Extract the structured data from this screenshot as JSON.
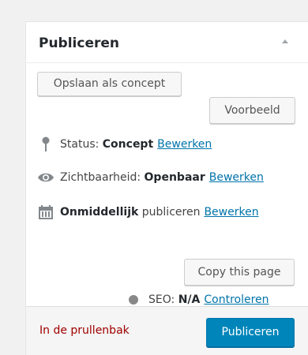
{
  "panel": {
    "title": "Publiceren"
  },
  "buttons": {
    "save_draft": "Opslaan als concept",
    "preview": "Voorbeeld",
    "copy_page": "Copy this page",
    "publish": "Publiceren"
  },
  "status": {
    "icon": "pin-icon",
    "label": "Status:",
    "value": "Concept",
    "edit": "Bewerken"
  },
  "visibility": {
    "icon": "eye-icon",
    "label": "Zichtbaarheid:",
    "value": "Openbaar",
    "edit": "Bewerken"
  },
  "schedule": {
    "icon": "calendar-icon",
    "value": "Onmiddellijk",
    "label": "publiceren",
    "edit": "Bewerken"
  },
  "seo": {
    "label": "SEO:",
    "value": "N/A",
    "check": "Controleren"
  },
  "footer": {
    "trash": "In de prullenbak"
  },
  "colors": {
    "link": "#0073aa",
    "trash": "#a00000",
    "publish_bg": "#0085ba"
  }
}
